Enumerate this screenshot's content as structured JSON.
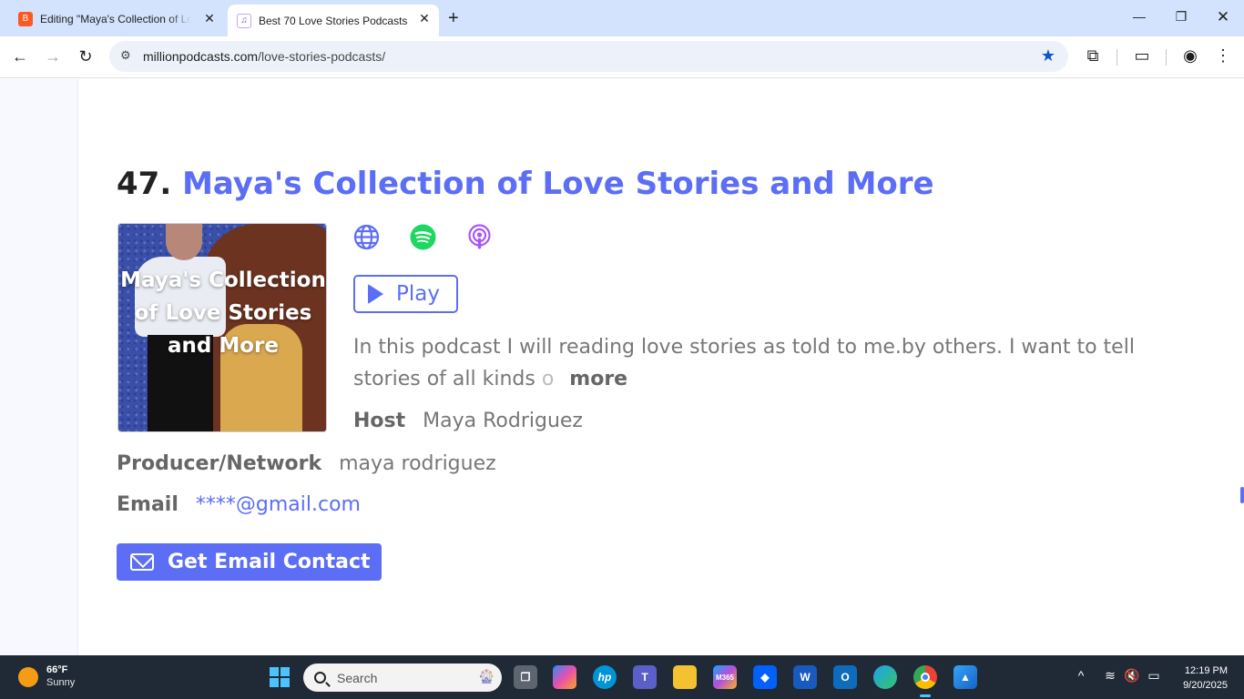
{
  "browser": {
    "tabs": [
      {
        "title": "Editing \"Maya's Collection of Lo",
        "active": false,
        "favicon": "blogger-icon"
      },
      {
        "title": "Best 70 Love Stories Podcasts",
        "active": true,
        "favicon": "millionpodcasts-icon"
      }
    ],
    "url_domain": "millionpodcasts.com",
    "url_path": "/love-stories-podcasts/",
    "bookmarked": true
  },
  "podcast": {
    "rank": "47.",
    "title": "Maya's Collection of Love Stories and More",
    "cover_text": "Maya's Collection of Love Stories and More",
    "links": [
      "website-icon",
      "spotify-icon",
      "apple-podcasts-icon"
    ],
    "play_label": "Play",
    "description": "In this podcast I will reading love stories as told to me.by others. I want to tell stories of all kinds",
    "description_fade": "o",
    "more_label": "more",
    "host_label": "Host",
    "host_value": "Maya Rodriguez",
    "producer_label": "Producer/Network",
    "producer_value": "maya rodriguez",
    "email_label": "Email",
    "email_value": "****@gmail.com",
    "email_button": "Get Email Contact"
  },
  "colors": {
    "accent": "#5b6ef5",
    "spotify": "#1ed760",
    "apple_podcasts": "#a855f7"
  },
  "taskbar": {
    "weather_temp": "66°F",
    "weather_cond": "Sunny",
    "search_placeholder": "Search",
    "apps": [
      "task-view",
      "copilot",
      "hp",
      "teams",
      "file-explorer",
      "microsoft-365",
      "dropbox",
      "word",
      "outlook",
      "edge",
      "chrome",
      "photos"
    ],
    "time": "12:19 PM",
    "date": "9/20/2025"
  }
}
